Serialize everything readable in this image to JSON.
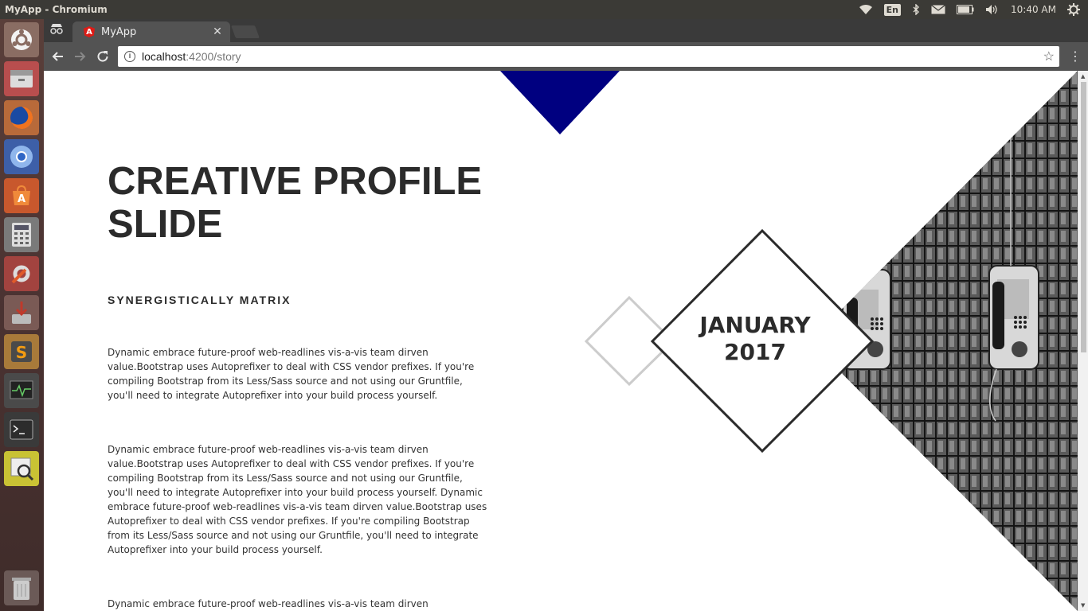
{
  "system": {
    "window_title": "MyApp - Chromium",
    "language": "En",
    "clock": "10:40 AM"
  },
  "browser": {
    "tab_title": "MyApp",
    "tab_favicon": "A",
    "url_host": "localhost",
    "url_path": ":4200/story"
  },
  "content": {
    "title": "CREATIVE PROFILE SLIDE",
    "subtitle": "SYNERGISTICALLY MATRIX",
    "paragraphs": [
      "Dynamic embrace future-proof web-readlines vis-a-vis team dirven value.Bootstrap uses Autoprefixer to deal with CSS vendor prefixes. If you're compiling Bootstrap from its Less/Sass source and not using our Gruntfile, you'll need to integrate Autoprefixer into your build process yourself.",
      "Dynamic embrace future-proof web-readlines vis-a-vis team dirven value.Bootstrap uses Autoprefixer to deal with CSS vendor prefixes. If you're compiling Bootstrap from its Less/Sass source and not using our Gruntfile, you'll need to integrate Autoprefixer into your build process yourself. Dynamic embrace future-proof web-readlines vis-a-vis team dirven value.Bootstrap uses Autoprefixer to deal with CSS vendor prefixes. If you're compiling Bootstrap from its Less/Sass source and not using our Gruntfile, you'll need to integrate Autoprefixer into your build process yourself.",
      "Dynamic embrace future-proof web-readlines vis-a-vis team dirven value.Bootstrap"
    ],
    "date_month": "JANUARY",
    "date_year": "2017"
  },
  "colors": {
    "accent_triangle": "#000080",
    "text_dark": "#2b2b2b",
    "diamond_light": "#cccccc"
  },
  "launcher_icons": [
    "ubuntu-dash-icon",
    "files-icon",
    "firefox-icon",
    "chromium-icon",
    "software-center-icon",
    "calculator-icon",
    "system-settings-icon",
    "installer-icon",
    "sublime-text-icon",
    "system-monitor-icon",
    "terminal-icon",
    "image-viewer-icon",
    "trash-icon"
  ]
}
